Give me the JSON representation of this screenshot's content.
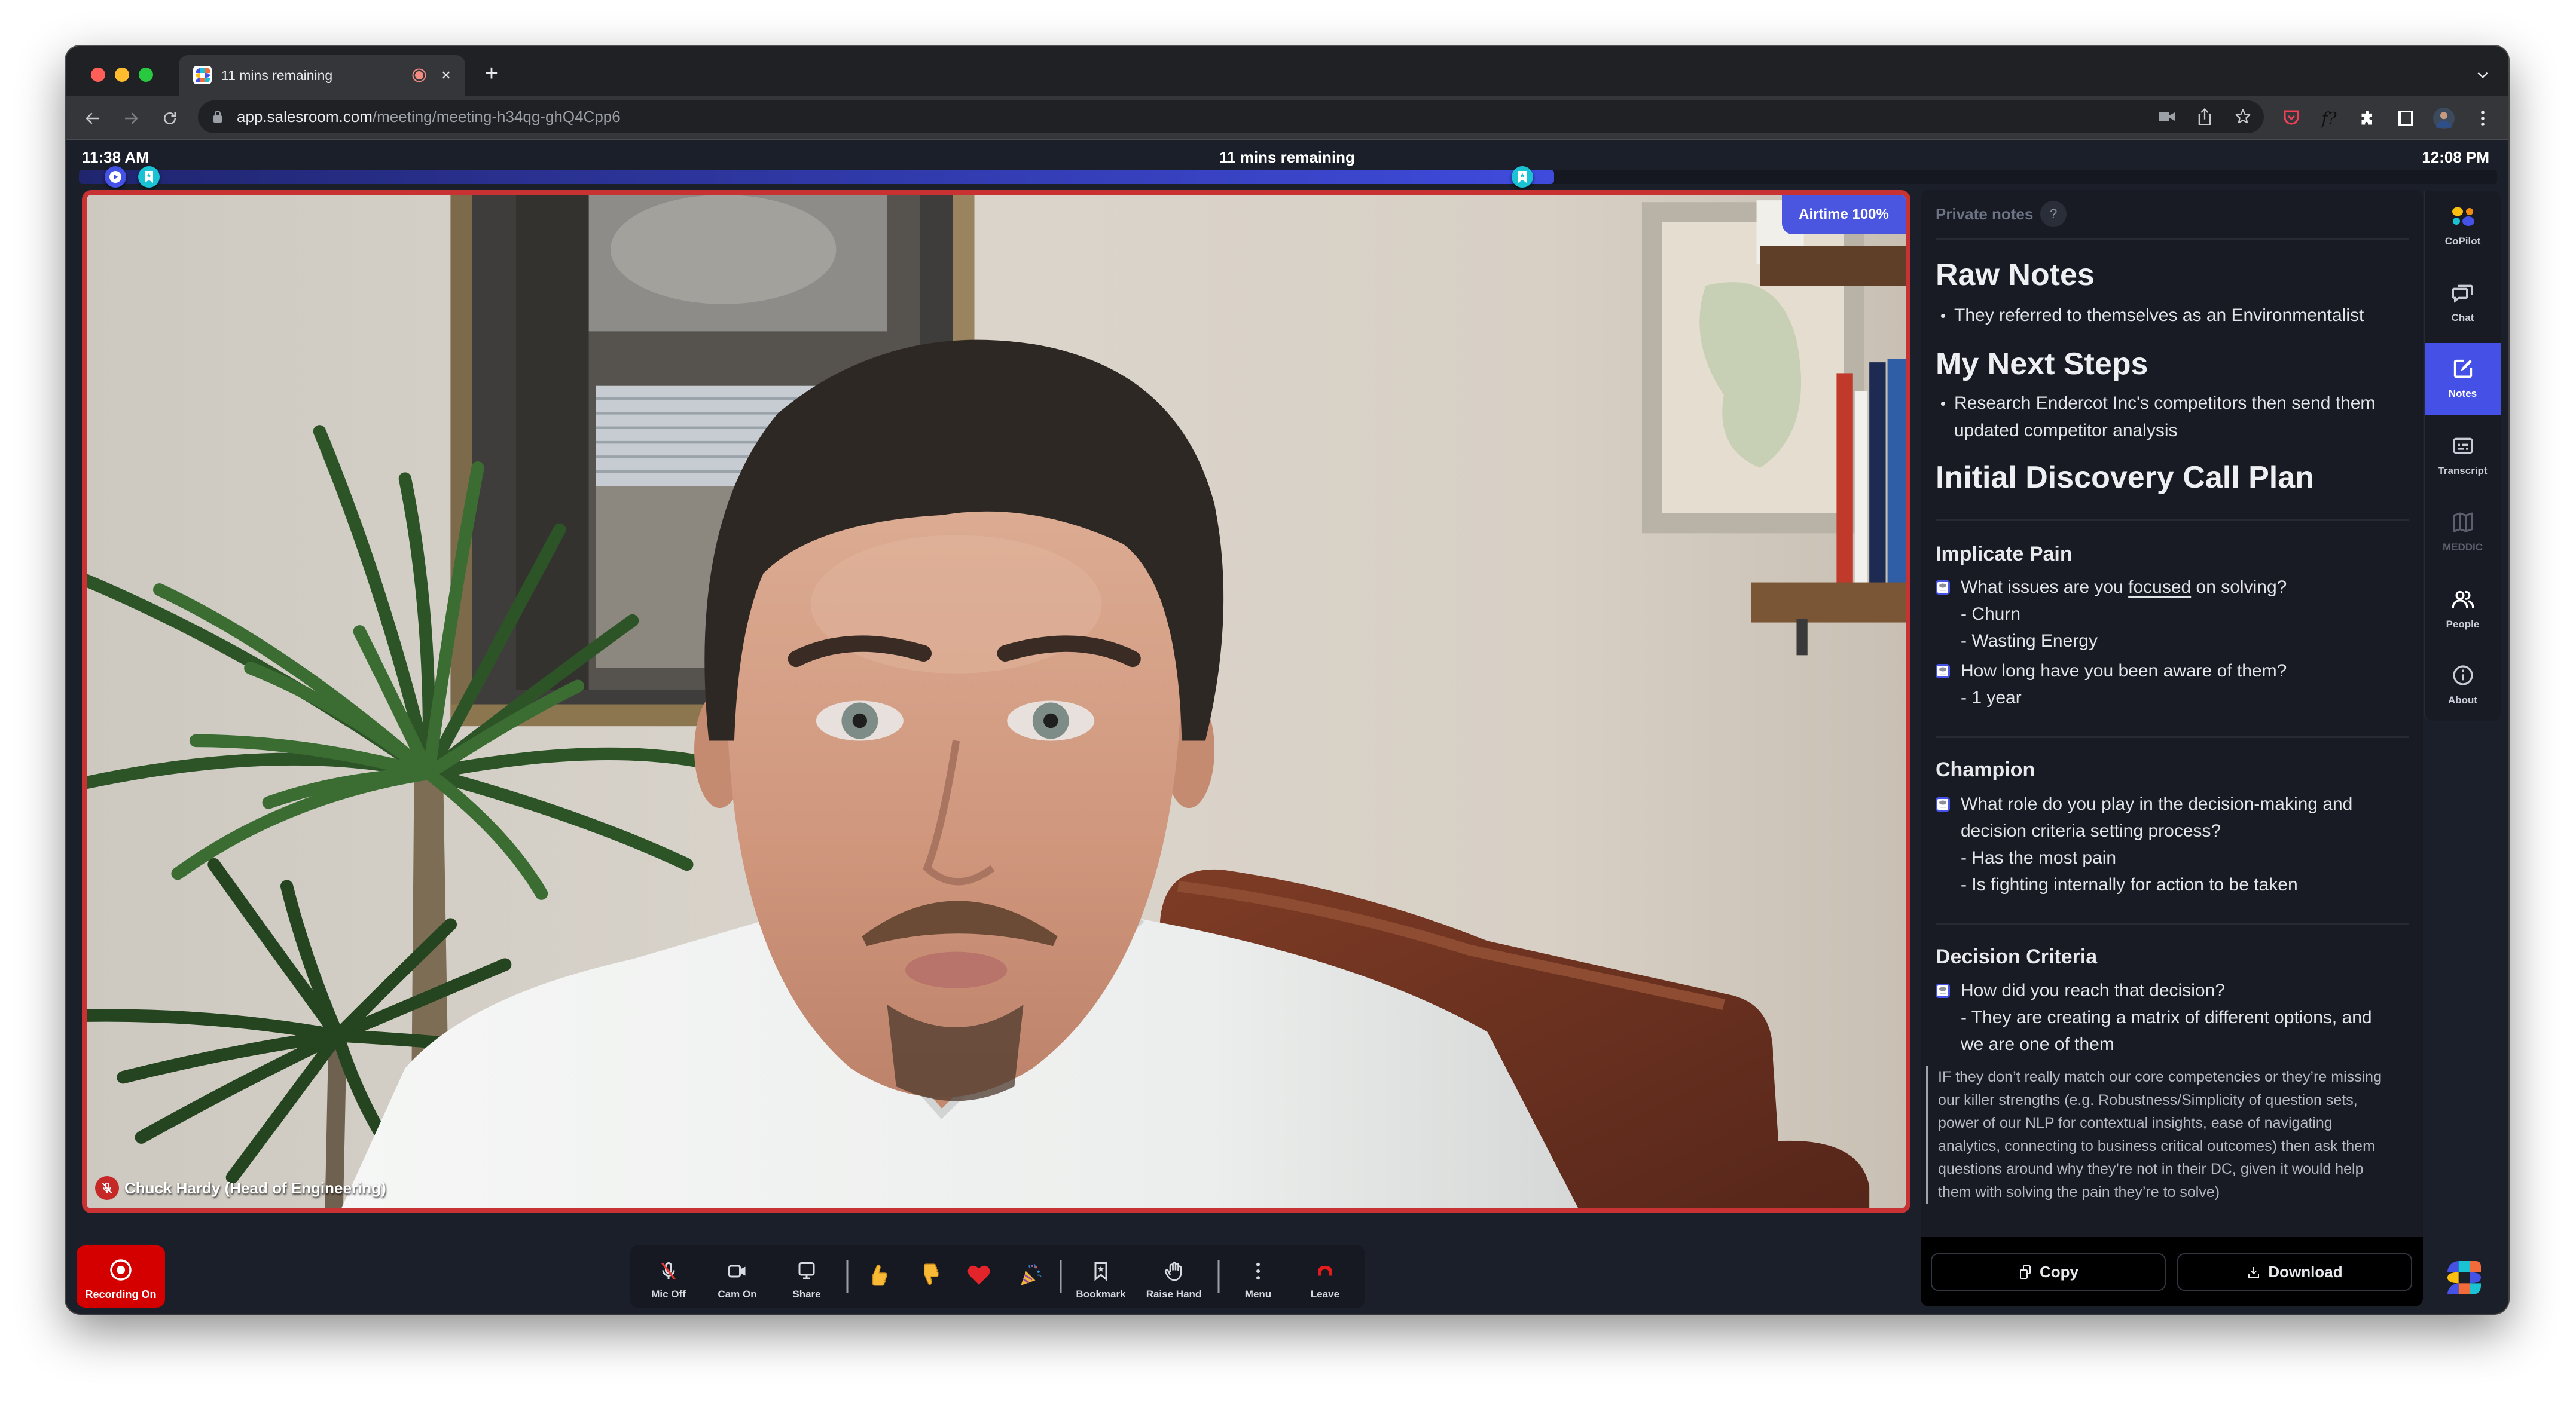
{
  "browser": {
    "tab": {
      "title": "11 mins remaining",
      "close_glyph": "×",
      "favicon": "salesroom-logo-icon",
      "status_icon": "recording-indicator-icon"
    },
    "new_tab_glyph": "+",
    "url": {
      "host": "app.salesroom.com",
      "path": "/meeting/meeting-h34qg-ghQ4Cpp6"
    },
    "extension_text": "f?"
  },
  "timeline": {
    "start_time": "11:38 AM",
    "end_time": "12:08 PM",
    "remaining_label": "11 mins remaining",
    "elapsed_fraction": 0.61,
    "markers": [
      {
        "type": "start",
        "icon": "play-icon",
        "at": 0.015
      },
      {
        "type": "bookmark",
        "icon": "bookmark-star-icon",
        "at": 0.029
      },
      {
        "type": "bookmark",
        "icon": "bookmark-star-icon",
        "at": 0.597
      }
    ]
  },
  "video": {
    "participant": "Chuck Hardy (Head of Engineering)",
    "mic_status": "muted",
    "airtime": "Airtime 100%"
  },
  "recording": {
    "label": "Recording On"
  },
  "call_toolbar": {
    "mic": "Mic Off",
    "camera": "Cam On",
    "share": "Share",
    "reactions": [
      "thumbs-up",
      "thumbs-down",
      "heart",
      "party-popper"
    ],
    "bookmark": "Bookmark",
    "raise_hand": "Raise Hand",
    "menu": "Menu",
    "leave": "Leave"
  },
  "notes": {
    "header": "Private notes",
    "help": "?",
    "raw_notes": {
      "title": "Raw Notes",
      "bullets": [
        "They referred to themselves as an Environmentalist"
      ]
    },
    "next_steps": {
      "title": "My Next Steps",
      "bullet_lines": [
        "Research Endercot Inc's competitors then send them",
        "updated competitor analysis"
      ]
    },
    "plan_title": "Initial Discovery Call Plan",
    "sections": [
      {
        "title": "Implicate Pain",
        "items": [
          {
            "question": {
              "pre": "What issues are you ",
              "underlined": "focused",
              "post": " on solving?"
            },
            "answers": [
              "- Churn",
              "- Wasting Energy"
            ]
          },
          {
            "question_lines": [
              "How long have you been aware of them?"
            ],
            "answers": [
              "- 1 year"
            ]
          }
        ]
      },
      {
        "title": "Champion",
        "items": [
          {
            "question_lines": [
              "What role do you play in the decision-making and",
              "decision criteria setting process?"
            ],
            "answers": [
              "- Has the most pain",
              "- Is fighting internally for action to be taken"
            ]
          }
        ]
      },
      {
        "title": "Decision Criteria",
        "items": [
          {
            "question_lines": [
              "How did you reach that decision?"
            ],
            "answers": [
              "- They are creating a matrix of different options, and",
              "we are one of them"
            ]
          }
        ]
      }
    ],
    "guidance_lines": [
      "IF they don’t really match our core competencies or they’re missing",
      "our killer strengths (e.g. Robustness/Simplicity of question sets,",
      "power of our NLP for contextual insights, ease of navigating",
      "analytics, connecting to business critical outcomes) then ask them",
      "questions around why they’re not in their DC, given it would help",
      "them with solving the pain they’re to solve)"
    ],
    "copy_label": "Copy",
    "download_label": "Download"
  },
  "rail": {
    "items": [
      {
        "label": "CoPilot",
        "icon": "copilot-icon"
      },
      {
        "label": "Chat",
        "icon": "chat-icon"
      },
      {
        "label": "Notes",
        "icon": "notes-icon",
        "active": true
      },
      {
        "label": "Transcript",
        "icon": "transcript-icon"
      },
      {
        "label": "MEDDIC",
        "icon": "map-icon",
        "disabled": true
      },
      {
        "label": "People",
        "icon": "people-icon"
      },
      {
        "label": "About",
        "icon": "info-icon"
      }
    ]
  },
  "theme": {
    "accent": "#4450e6",
    "speaker_border": "#c83232",
    "recording": "#d40000",
    "background": "#1b1f2a",
    "panel": "#181b24"
  }
}
